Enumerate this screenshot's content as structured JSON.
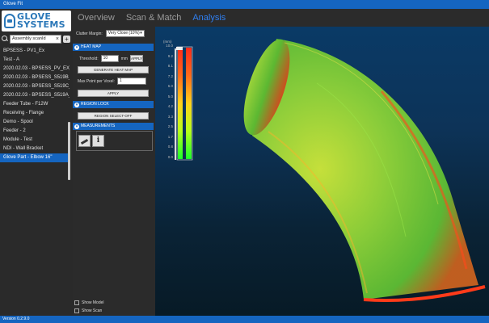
{
  "window": {
    "title": "Glove Fit"
  },
  "logo": {
    "line1": "GLOVE",
    "line2": "SYSTEMS"
  },
  "search": {
    "value": "Assembly scanId",
    "clear": "×",
    "add": "+"
  },
  "projects": [
    "BPSESS - PV1_Ex",
    "Test - A",
    "2020.02.03 - BPSESS_PV_EX_...",
    "2020.02.03 - BPSESS_S519B_...",
    "2020.02.03 - BPSESS_S519C_...",
    "2020.02.03 - BPSESS_S519A_...",
    "Feeder Tube - F12W",
    "Receiving - Flange",
    "Demo - Spool",
    "Feeder - 2",
    "Module - Test",
    "NDI - Wall Bracket",
    "Glove Part - Elbow 16\""
  ],
  "selected_project_index": 12,
  "tabs": [
    "Overview",
    "Scan & Match",
    "Analysis"
  ],
  "active_tab": "Analysis",
  "panel": {
    "clutter_label": "Clutter Margin:",
    "clutter_value": "Very Close (10%)",
    "heatmap": {
      "title": "HEAT MAP",
      "threshold_label": "Threshold:",
      "threshold_value": "10",
      "threshold_unit": "mm",
      "apply1": "APPLY",
      "generate": "GENERATE HEAT MAP",
      "max_points_label": "Max Point per Voxel:",
      "max_points_value": "1",
      "apply2": "APPLY"
    },
    "region_lock": {
      "title": "REGION LOCK",
      "button": "REGION SELECT-OFF"
    },
    "measurements": {
      "title": "MEASUREMENTS",
      "info": "i"
    },
    "show_model": "Show Model",
    "show_scan": "Show Scan"
  },
  "legend": {
    "unit": "(mm)",
    "ticks": [
      "10.0",
      "9.2",
      "8.1",
      "7.2",
      "6.0",
      "5.0",
      "4.2",
      "3.3",
      "2.5",
      "1.7",
      "0.8",
      "0.0"
    ]
  },
  "status": {
    "version": "Version 0.2.9.0"
  },
  "colors": {
    "accent": "#1565c0",
    "tab_active": "#2f7ff0"
  }
}
